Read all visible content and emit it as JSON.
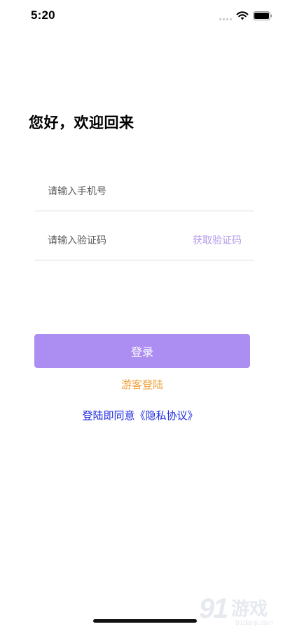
{
  "status_bar": {
    "time": "5:20",
    "icons": [
      "signal-dots-icon",
      "wifi-icon",
      "battery-icon"
    ]
  },
  "login": {
    "greeting": "您好，欢迎回来",
    "phone_placeholder": "请输入手机号",
    "code_placeholder": "请输入验证码",
    "get_code_label": "获取验证码",
    "login_button_label": "登录",
    "guest_login_label": "游客登陆",
    "privacy_label": "登陆即同意《隐私协议》"
  },
  "watermark": {
    "logo_text": "91游戏",
    "domain": "91danji.com"
  },
  "colors": {
    "accent": "#ac8ef2",
    "get_code": "#b49ae8",
    "guest": "#f0a03a",
    "privacy_link": "#1f2ce0"
  }
}
